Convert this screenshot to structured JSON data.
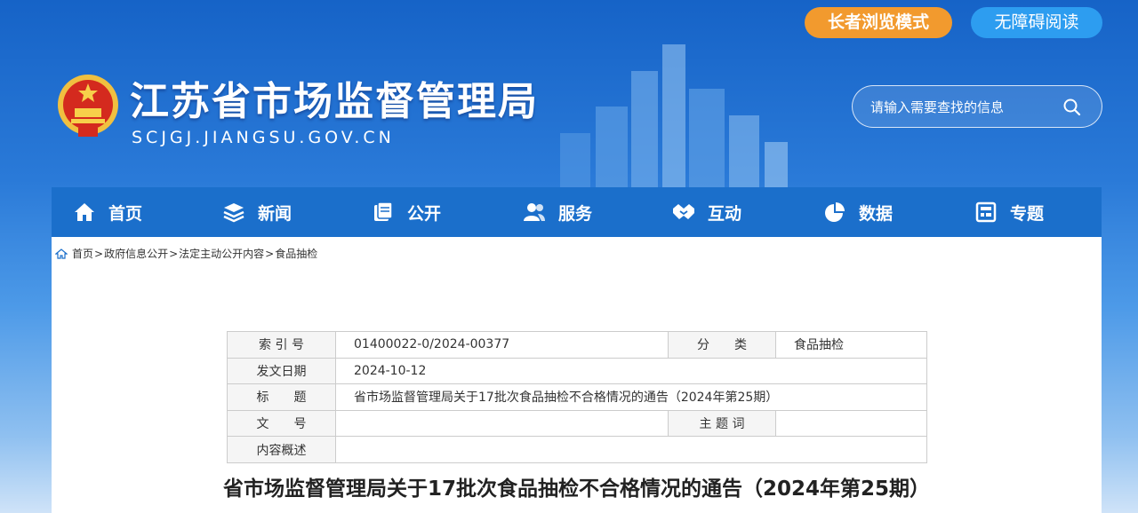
{
  "header": {
    "site_title": "江苏省市场监督管理局",
    "site_domain": "SCJGJ.JIANGSU.GOV.CN",
    "elder_mode_label": "长者浏览模式",
    "accessibility_label": "无障碍阅读",
    "search_placeholder": "请输入需要查找的信息"
  },
  "nav": {
    "items": [
      {
        "label": "首页",
        "icon": "home-icon"
      },
      {
        "label": "新闻",
        "icon": "layers-icon"
      },
      {
        "label": "公开",
        "icon": "documents-icon"
      },
      {
        "label": "服务",
        "icon": "people-icon"
      },
      {
        "label": "互动",
        "icon": "handshake-icon"
      },
      {
        "label": "数据",
        "icon": "pie-chart-icon"
      },
      {
        "label": "专题",
        "icon": "panel-icon"
      }
    ]
  },
  "breadcrumb": {
    "items": [
      "首页",
      "政府信息公开",
      "法定主动公开内容",
      "食品抽检"
    ],
    "separator": ">"
  },
  "meta": {
    "index_label": "索 引 号",
    "index_value": "01400022-0/2024-00377",
    "category_label": "分　　类",
    "category_value": "食品抽检",
    "date_label": "发文日期",
    "date_value": "2024-10-12",
    "title_label": "标　　题",
    "title_value": "省市场监督管理局关于17批次食品抽检不合格情况的通告（2024年第25期）",
    "doc_no_label": "文　　号",
    "doc_no_value": "",
    "keywords_label": "主 题 词",
    "keywords_value": "",
    "summary_label": "内容概述",
    "summary_value": ""
  },
  "article": {
    "title": "省市场监督管理局关于17批次食品抽检不合格情况的通告（2024年第25期）"
  },
  "colors": {
    "nav_bg": "#1b6fcb",
    "elder_btn": "#f29a2e",
    "access_btn": "#2d9df0",
    "header_blue": "#1663c7"
  }
}
